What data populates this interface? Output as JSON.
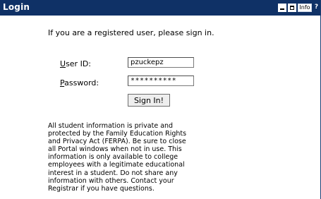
{
  "window": {
    "title": "Login",
    "controls": {
      "info_label": "Info",
      "help_label": "?"
    }
  },
  "form": {
    "intro": "If you are a registered user, please sign in.",
    "user_id_label_accesskey": "U",
    "user_id_label_rest": "ser ID:",
    "user_id_value": "pzuckepz",
    "password_label_accesskey": "P",
    "password_label_rest": "assword:",
    "password_value": "**********",
    "sign_in_label": "Sign In!"
  },
  "notice": {
    "lines": [
      "All student information is private and",
      "protected by the Family Education Rights",
      "and Privacy Act (FERPA). Be sure to close",
      "all Portal windows when not in use. This",
      "information is only available to college",
      "employees with a legitimate educational",
      "interest in a student. Do not share any",
      "information with others. Contact your",
      "Registrar if you have questions."
    ]
  },
  "colors": {
    "titlebar": "#0f3166",
    "background": "#ffffff"
  },
  "icons": [
    "minimize-icon",
    "maximize-icon",
    "help-icon"
  ]
}
